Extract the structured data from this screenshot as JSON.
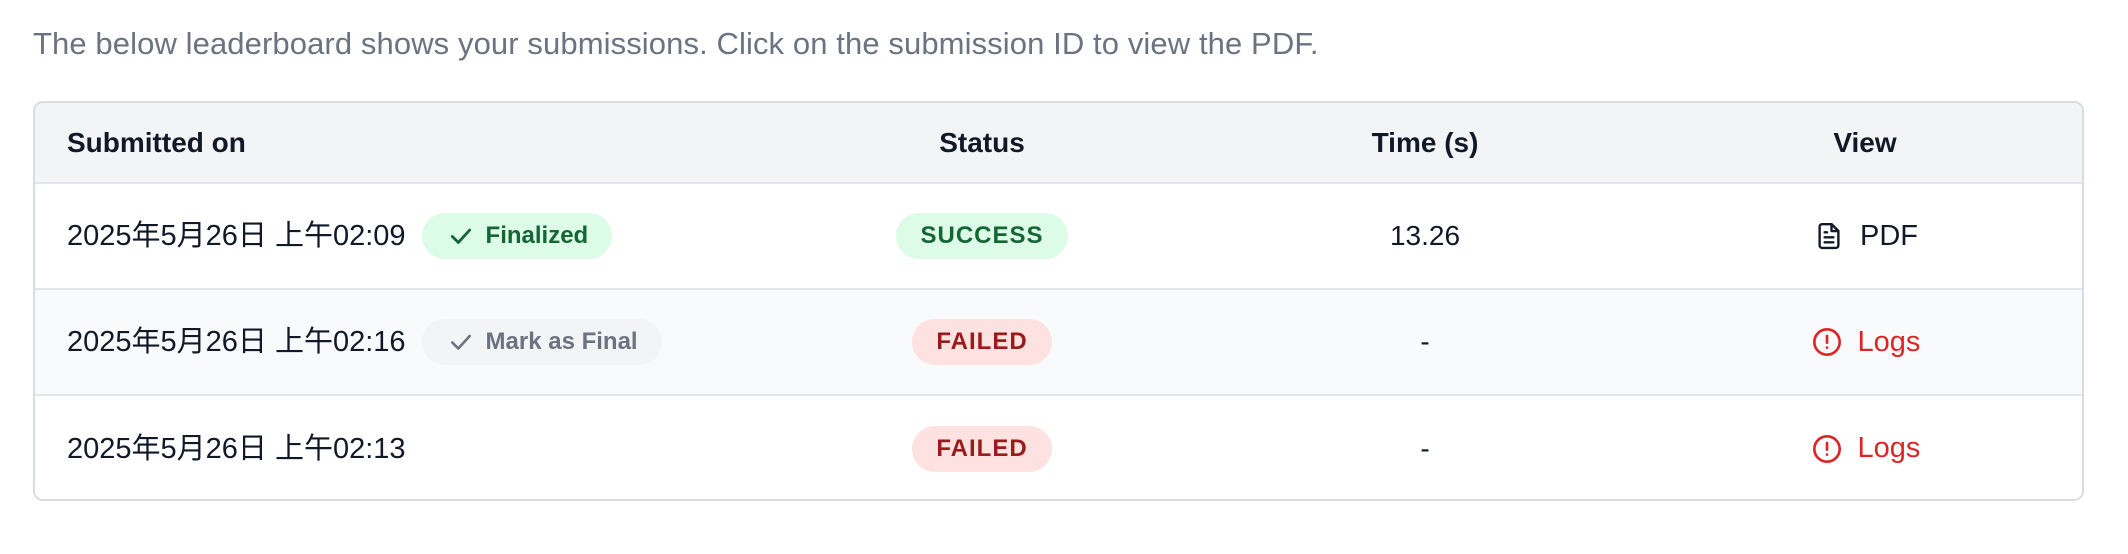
{
  "intro": "The below leaderboard shows your submissions. Click on the submission ID to view the PDF.",
  "columns": {
    "submitted_on": "Submitted on",
    "status": "Status",
    "time": "Time (s)",
    "view": "View"
  },
  "rows": [
    {
      "date": "2025年5月26日 上午02:09",
      "final_label": "Finalized",
      "status": "SUCCESS",
      "time": "13.26",
      "view_label": "PDF"
    },
    {
      "date": "2025年5月26日 上午02:16",
      "final_label": "Mark as Final",
      "status": "FAILED",
      "time": "-",
      "view_label": "Logs"
    },
    {
      "date": "2025年5月26日 上午02:13",
      "status": "FAILED",
      "time": "-",
      "view_label": "Logs"
    }
  ],
  "icons": {
    "finalized": "check-icon",
    "mark_final": "check-icon",
    "pdf": "document-icon",
    "logs": "alert-circle-icon"
  },
  "colors": {
    "success_bg": "#dcfce7",
    "success_text": "#166534",
    "failed_bg": "#fee2e2",
    "failed_text": "#991b1b",
    "logs_link": "#dc2626",
    "header_bg": "#f3f4f6"
  }
}
